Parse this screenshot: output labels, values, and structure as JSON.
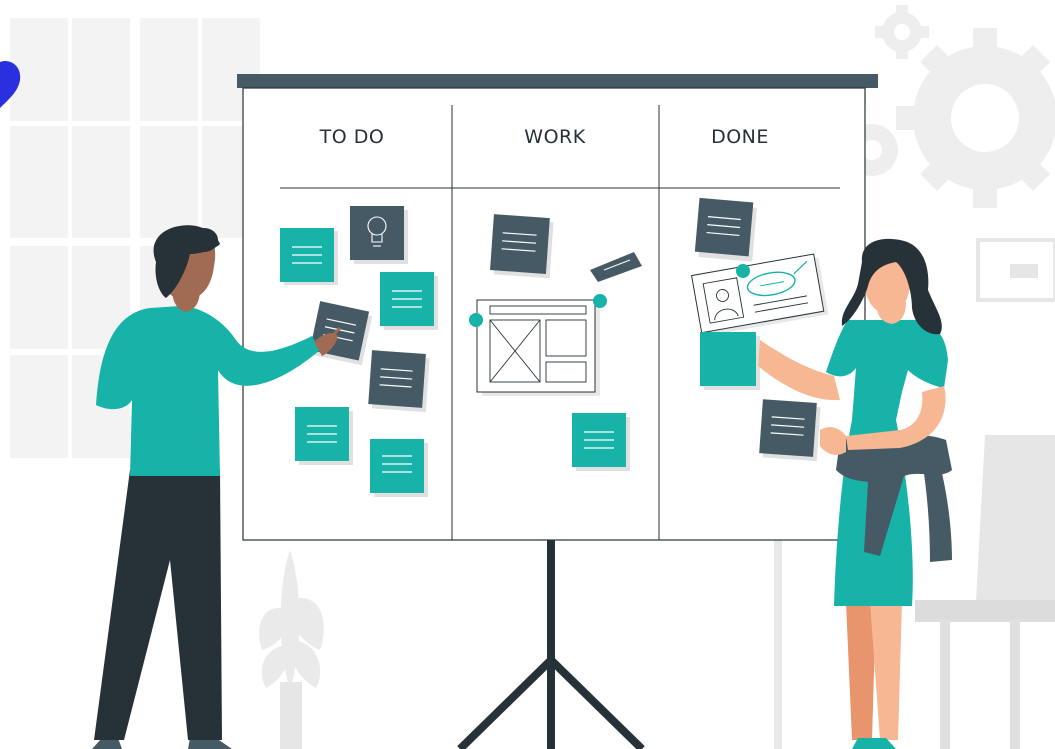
{
  "board": {
    "columns": [
      {
        "label": "TO DO"
      },
      {
        "label": "WORK"
      },
      {
        "label": "DONE"
      }
    ]
  },
  "colors": {
    "teal": "#17b3a9",
    "dark": "#455a64",
    "ink": "#263238",
    "light_gray": "#f2f2f2",
    "skin_dark": "#a06b52",
    "skin_light": "#f6b792",
    "accent_blue": "#2a2fe0"
  },
  "icons": [
    "gear-icon",
    "lightbulb-icon",
    "user-profile-icon",
    "wireframe-icon",
    "plant-icon",
    "chair-icon"
  ]
}
